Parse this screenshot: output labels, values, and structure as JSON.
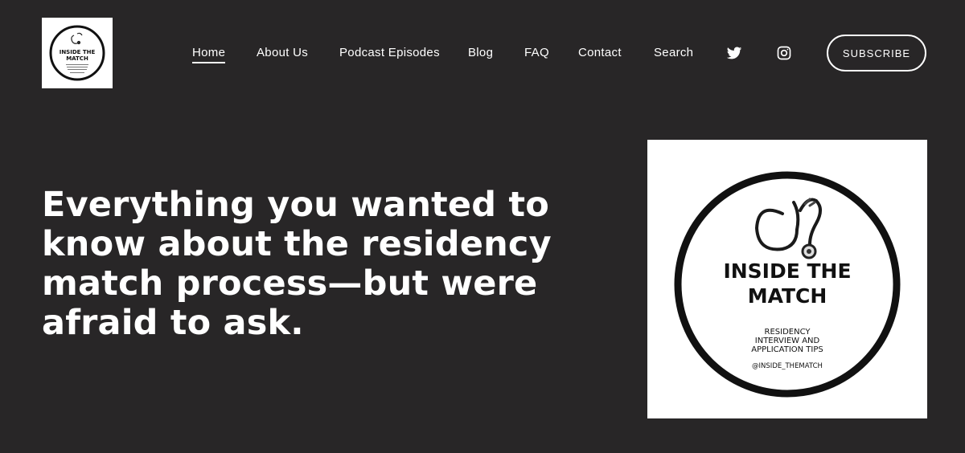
{
  "nav": {
    "logo_line1": "INSIDE THE",
    "logo_line2": "MATCH",
    "items": [
      {
        "label": "Home",
        "active": true
      },
      {
        "label": "About Us"
      },
      {
        "label": "Podcast Episodes"
      },
      {
        "label": "Blog"
      },
      {
        "label": "FAQ"
      },
      {
        "label": "Contact"
      },
      {
        "label": "Search"
      }
    ],
    "social": [
      "twitter-icon",
      "instagram-icon"
    ],
    "subscribe_label": "SUBSCRIBE"
  },
  "hero": {
    "title": "Everything you wanted to know about the residency match process—but were afraid to ask.",
    "image": {
      "line1": "INSIDE THE",
      "line2": "MATCH",
      "sub1": "RESIDENCY",
      "sub2": "INTERVIEW AND",
      "sub3": "APPLICATION TIPS",
      "handle": "@INSIDE_THEMATCH"
    }
  },
  "colors": {
    "background": "#282627",
    "text": "#ffffff",
    "logo_bg": "#ffffff",
    "logo_ink": "#111111"
  }
}
